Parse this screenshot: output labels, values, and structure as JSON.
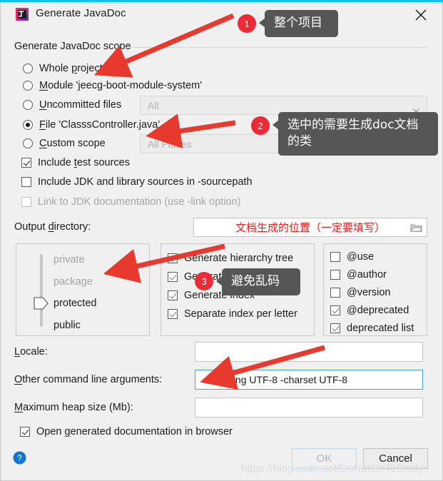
{
  "window": {
    "title": "Generate JavaDoc",
    "app_icon": "intellij-idea-icon",
    "close_icon": "close-icon",
    "accent_color": "#0ec3f0"
  },
  "scope": {
    "group_label": "Generate JavaDoc scope",
    "options": [
      {
        "label": "Whole project",
        "checked": false
      },
      {
        "label": "Module 'jeecg-boot-module-system'",
        "checked": false
      },
      {
        "label": "Uncommitted files",
        "checked": false
      },
      {
        "label": "File 'ClasssController.java'",
        "checked": true
      },
      {
        "label": "Custom scope",
        "checked": false
      }
    ],
    "uncommitted_combo_value": "All",
    "custom_scope_combo_value": "All Places",
    "custom_scope_browse_label": "...",
    "chevron_icon": "chevron-down-icon"
  },
  "sources": {
    "include_test_sources": {
      "label": "Include test sources",
      "checked": true,
      "enabled": true
    },
    "include_jdk_sources": {
      "label": "Include JDK and library sources in -sourcepath",
      "checked": false,
      "enabled": true
    },
    "link_to_jdk_doc": {
      "label": "Link to JDK documentation (use -link option)",
      "checked": false,
      "enabled": false
    }
  },
  "output": {
    "label": "Output directory:",
    "value": "文档生成的位置（一定要填写）",
    "value_color": "#f02020",
    "browse_icon": "folder-icon"
  },
  "visibility": {
    "items": [
      {
        "label": "private",
        "active": false
      },
      {
        "label": "package",
        "active": false
      },
      {
        "label": "protected",
        "active": true
      },
      {
        "label": "public",
        "active": true
      }
    ],
    "selected": "protected"
  },
  "generate_options": [
    {
      "label": "Generate hierarchy tree",
      "checked": true
    },
    {
      "label": "Generate navigation bar",
      "checked": true
    },
    {
      "label": "Generate index",
      "checked": true
    },
    {
      "label": "Separate index per letter",
      "checked": true
    }
  ],
  "tag_options": [
    {
      "label": "@use",
      "checked": false
    },
    {
      "label": "@author",
      "checked": false
    },
    {
      "label": "@version",
      "checked": false
    },
    {
      "label": "@deprecated",
      "checked": true
    },
    {
      "label": "deprecated list",
      "checked": true
    }
  ],
  "fields": {
    "locale": {
      "label": "Locale:",
      "value": ""
    },
    "other_args": {
      "label": "Other command line arguments:",
      "value": "-encoding UTF-8 -charset UTF-8",
      "focused": true
    },
    "max_heap": {
      "label": "Maximum heap size (Mb):",
      "value": ""
    }
  },
  "open_in_browser": {
    "label": "Open generated documentation in browser",
    "checked": true
  },
  "buttons": {
    "help_icon": "help-icon",
    "ok": {
      "label": "OK",
      "enabled": false
    },
    "cancel": {
      "label": "Cancel",
      "enabled": true
    }
  },
  "annotations": [
    {
      "badge": "1",
      "text": "整个项目"
    },
    {
      "badge": "2",
      "text": "选中的需要生成doc文档的类"
    },
    {
      "badge": "3",
      "text": "避免乱码"
    }
  ],
  "watermark": "https://blog.csdn.net/DoNotGoToStudy"
}
